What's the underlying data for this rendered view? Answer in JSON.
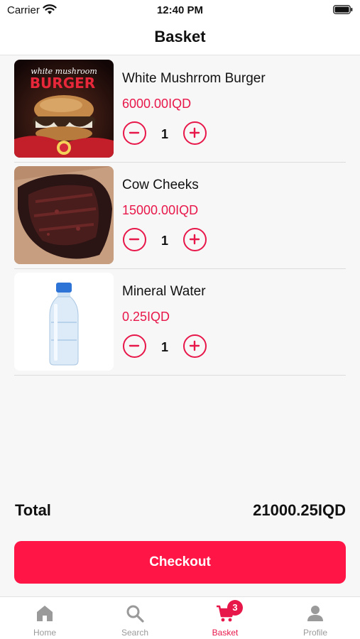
{
  "status_bar": {
    "carrier": "Carrier",
    "time": "12:40 PM",
    "wifi_icon": "wifi-icon",
    "battery_icon": "battery-icon"
  },
  "header": {
    "title": "Basket"
  },
  "items": [
    {
      "name": "White Mushrrom Burger",
      "price": "6000.00IQD",
      "quantity": "1",
      "image": "burger-photo"
    },
    {
      "name": "Cow Cheeks",
      "price": "15000.00IQD",
      "quantity": "1",
      "image": "meat-photo"
    },
    {
      "name": "Mineral Water",
      "price": "0.25IQD",
      "quantity": "1",
      "image": "water-bottle-photo"
    }
  ],
  "thumb_text": {
    "burger_line1": "white mushroom",
    "burger_line2": "BURGER"
  },
  "summary": {
    "total_label": "Total",
    "total_value": "21000.25IQD"
  },
  "checkout": {
    "label": "Checkout"
  },
  "tab_bar": {
    "tabs": [
      {
        "label": "Home",
        "icon": "home-icon",
        "active": false
      },
      {
        "label": "Search",
        "icon": "search-icon",
        "active": false
      },
      {
        "label": "Basket",
        "icon": "cart-icon",
        "active": true,
        "badge": "3"
      },
      {
        "label": "Profile",
        "icon": "person-icon",
        "active": false
      }
    ]
  },
  "colors": {
    "accent": "#e8174a",
    "checkout_bg": "#ff1546",
    "background": "#f7f7f7",
    "inactive_tab": "#9a9a9a"
  }
}
